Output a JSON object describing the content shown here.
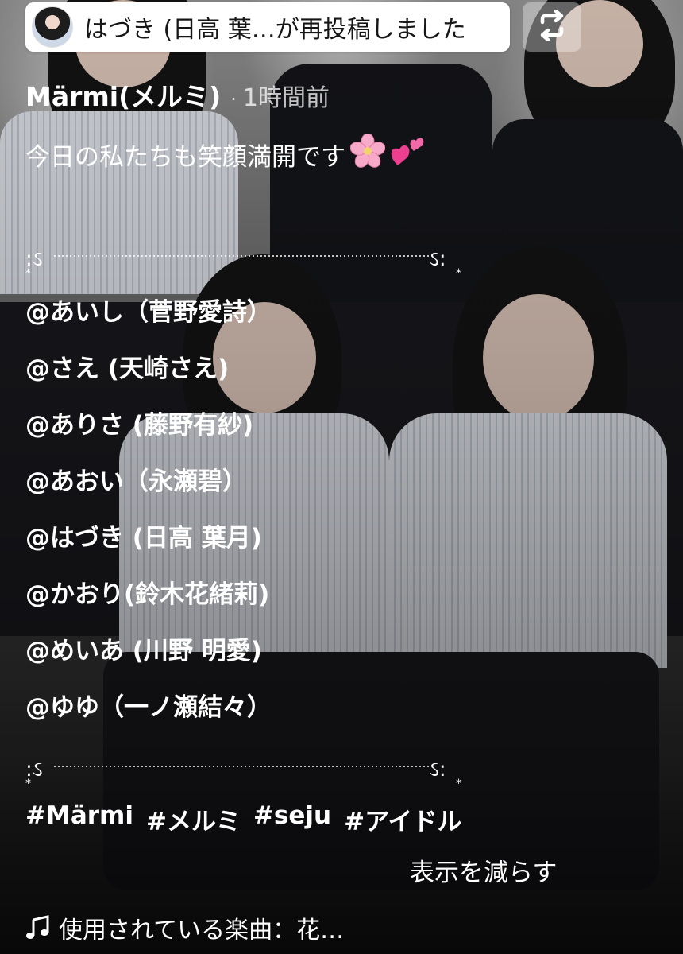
{
  "repost": {
    "text": "はづき (日高 葉…が再投稿しました"
  },
  "author": {
    "name": "Märmi(メルミ)",
    "separator": "·",
    "time": "1時間前"
  },
  "caption": {
    "text": "今日の私たちも笑顔満開です",
    "emoji_flower": "🌸",
    "emoji_hearts": "💕"
  },
  "mentions": [
    "@あいし（菅野愛詩）",
    "@さえ (天崎さえ)",
    "@ありさ (藤野有紗)",
    "@あおい（永瀬碧）",
    "@はづき (日高 葉月)",
    "@かおり(鈴木花緒莉)",
    "@めいあ (川野 明愛)",
    "@ゆゆ（一ノ瀬結々）"
  ],
  "hashtags": [
    "#Märmi",
    "#メルミ",
    "#seju",
    "#アイドル"
  ],
  "show_less_label": "表示を減らす",
  "music": {
    "label": "使用されている楽曲：花…"
  },
  "icons": {
    "repost": "repost-icon",
    "music": "music-note-icon",
    "divider": "ornament-divider"
  }
}
